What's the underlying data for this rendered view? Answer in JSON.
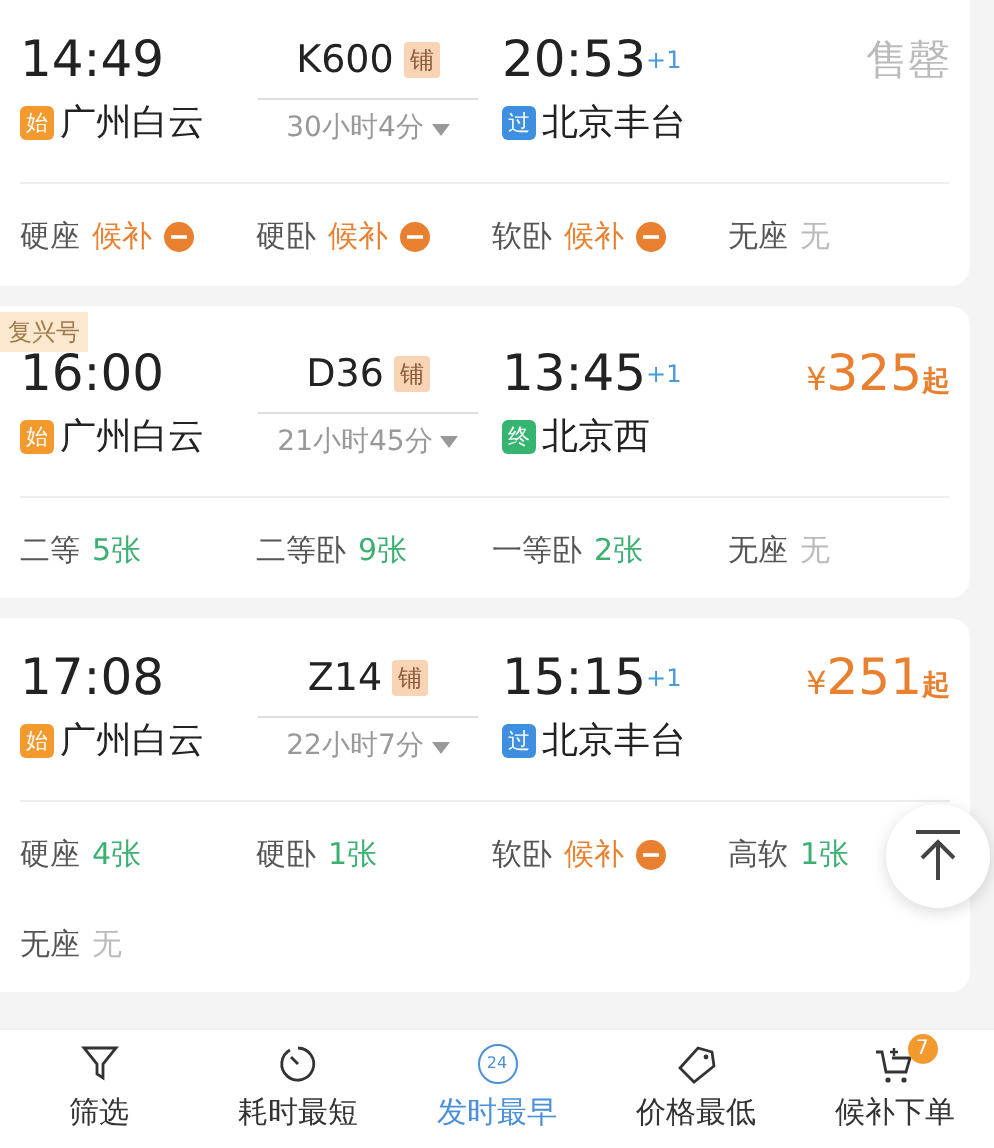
{
  "trains": [
    {
      "depart_time": "14:49",
      "train_no": "K600",
      "berth_badge": "铺",
      "duration": "30小时4分",
      "arrive_time": "20:53",
      "day_offset": "+1",
      "from": {
        "badge": "始",
        "kind": "start",
        "name": "广州白云"
      },
      "to": {
        "badge": "过",
        "kind": "pass",
        "name": "北京丰台"
      },
      "price": {
        "kind": "soldout",
        "text": "售罄"
      },
      "seats": [
        {
          "name": "硬座",
          "status": "候补",
          "kind": "waitlist"
        },
        {
          "name": "硬卧",
          "status": "候补",
          "kind": "waitlist"
        },
        {
          "name": "软卧",
          "status": "候补",
          "kind": "waitlist"
        },
        {
          "name": "无座",
          "status": "无",
          "kind": "none"
        }
      ]
    },
    {
      "tag": "复兴号",
      "depart_time": "16:00",
      "train_no": "D36",
      "berth_badge": "铺",
      "duration": "21小时45分",
      "arrive_time": "13:45",
      "day_offset": "+1",
      "from": {
        "badge": "始",
        "kind": "start",
        "name": "广州白云"
      },
      "to": {
        "badge": "终",
        "kind": "end",
        "name": "北京西"
      },
      "price": {
        "kind": "price",
        "currency": "¥",
        "amount": "325",
        "suffix": "起"
      },
      "seats": [
        {
          "name": "二等",
          "status": "5张",
          "kind": "available"
        },
        {
          "name": "二等卧",
          "status": "9张",
          "kind": "available"
        },
        {
          "name": "一等卧",
          "status": "2张",
          "kind": "available"
        },
        {
          "name": "无座",
          "status": "无",
          "kind": "none"
        }
      ]
    },
    {
      "depart_time": "17:08",
      "train_no": "Z14",
      "berth_badge": "铺",
      "duration": "22小时7分",
      "arrive_time": "15:15",
      "day_offset": "+1",
      "from": {
        "badge": "始",
        "kind": "start",
        "name": "广州白云"
      },
      "to": {
        "badge": "过",
        "kind": "pass",
        "name": "北京丰台"
      },
      "price": {
        "kind": "price",
        "currency": "¥",
        "amount": "251",
        "suffix": "起"
      },
      "seats": [
        {
          "name": "硬座",
          "status": "4张",
          "kind": "available"
        },
        {
          "name": "硬卧",
          "status": "1张",
          "kind": "available"
        },
        {
          "name": "软卧",
          "status": "候补",
          "kind": "waitlist"
        },
        {
          "name": "高软",
          "status": "1张",
          "kind": "available"
        },
        {
          "name": "无座",
          "status": "无",
          "kind": "none"
        }
      ]
    }
  ],
  "bottom_nav": [
    {
      "label": "筛选",
      "selected": false
    },
    {
      "label": "耗时最短",
      "selected": false
    },
    {
      "label": "发时最早",
      "icon_text": "24",
      "selected": true
    },
    {
      "label": "价格最低",
      "selected": false
    },
    {
      "label": "候补下单",
      "badge": "7",
      "selected": false
    }
  ]
}
